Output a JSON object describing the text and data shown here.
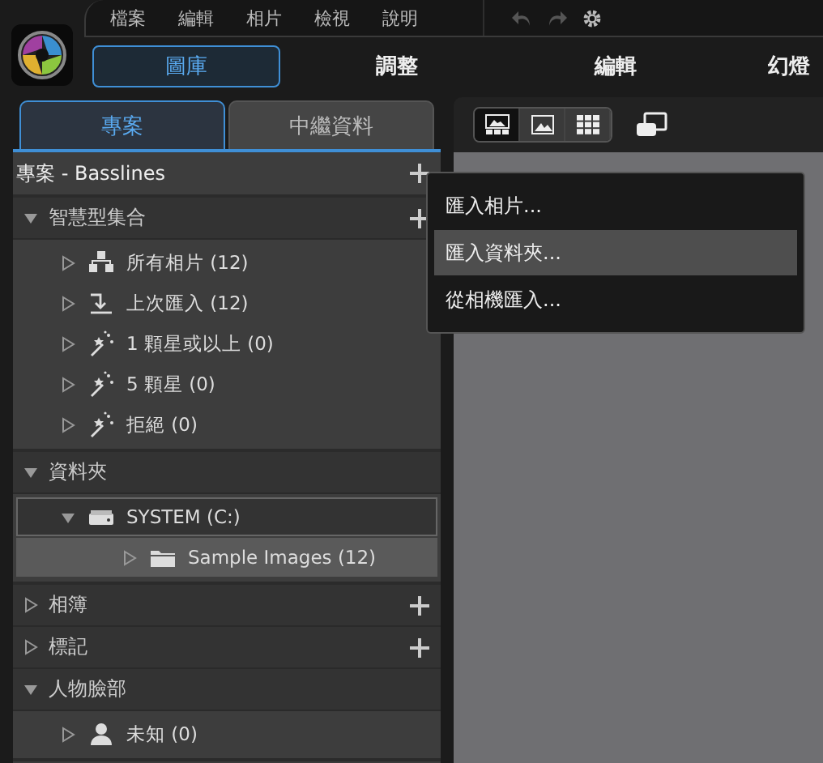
{
  "menu_bar": {
    "items": [
      "檔案",
      "編輯",
      "相片",
      "檢視",
      "說明"
    ]
  },
  "modules": [
    {
      "label": "圖庫",
      "selected": true
    },
    {
      "label": "調整",
      "selected": false
    },
    {
      "label": "編輯",
      "selected": false
    },
    {
      "label": "幻燈",
      "selected": false
    }
  ],
  "panel_tabs": [
    {
      "label": "專案",
      "selected": true
    },
    {
      "label": "中繼資料",
      "selected": false
    }
  ],
  "project": {
    "title": "專案 - Basslines"
  },
  "sections": [
    {
      "label": "智慧型集合",
      "expanded": true,
      "has_add": true,
      "items": [
        {
          "kind": "all",
          "label": "所有相片 (12)",
          "selected": false,
          "focused": false
        },
        {
          "kind": "recent",
          "label": "上次匯入 (12)",
          "selected": false,
          "focused": false
        },
        {
          "kind": "smart",
          "label": "1 顆星或以上 (0)",
          "selected": false,
          "focused": false
        },
        {
          "kind": "smart",
          "label": "5 顆星 (0)",
          "selected": false,
          "focused": false
        },
        {
          "kind": "smart",
          "label": "拒絕 (0)",
          "selected": false,
          "focused": false
        }
      ]
    },
    {
      "label": "資料夾",
      "expanded": true,
      "has_add": false,
      "items": [
        {
          "kind": "drive",
          "label": "SYSTEM (C:)",
          "selected": false,
          "focused": true,
          "expanded": true,
          "children": [
            {
              "kind": "folder",
              "label": "Sample Images (12)",
              "selected": true,
              "focused": false,
              "expanded": false
            }
          ]
        }
      ]
    },
    {
      "label": "相簿",
      "expanded": false,
      "has_add": true
    },
    {
      "label": "標記",
      "expanded": false,
      "has_add": true
    },
    {
      "label": "人物臉部",
      "expanded": true,
      "has_add": false,
      "items": [
        {
          "kind": "person",
          "label": "未知 (0)",
          "selected": false,
          "focused": false
        }
      ]
    }
  ],
  "view_modes": [
    {
      "kind": "filmstrip",
      "selected": true
    },
    {
      "kind": "single",
      "selected": false
    },
    {
      "kind": "grid",
      "selected": false
    }
  ],
  "import_menu": {
    "items": [
      {
        "label": "匯入相片...",
        "selected": false
      },
      {
        "label": "匯入資料夾...",
        "selected": true
      },
      {
        "label": "從相機匯入...",
        "selected": false
      }
    ]
  }
}
